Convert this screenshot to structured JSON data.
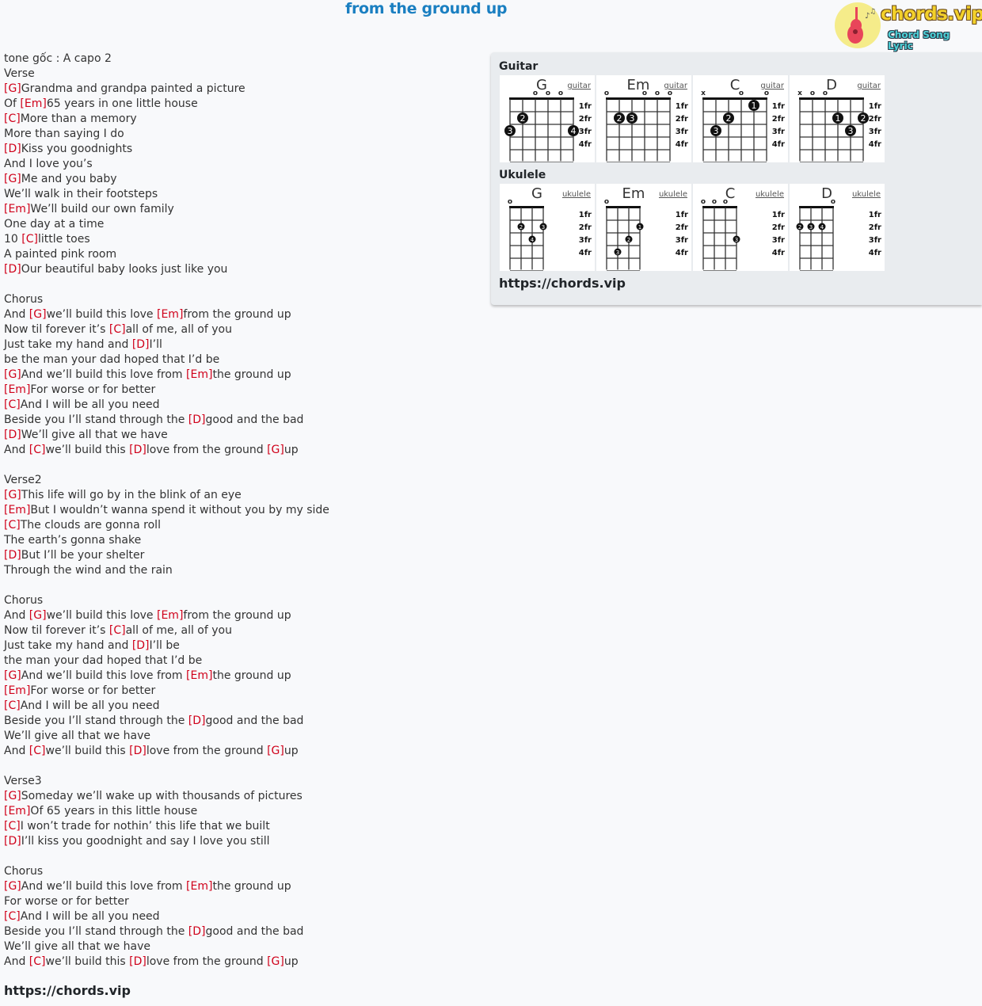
{
  "song": {
    "title": "from the ground up"
  },
  "logo": {
    "name": "chords.vip",
    "tagline": "Chord Song Lyric"
  },
  "lyrics": [
    [
      {
        "t": "tone gốc : A capo 2"
      }
    ],
    [
      {
        "t": "Verse"
      }
    ],
    [
      {
        "c": "[G]"
      },
      {
        "t": "Grandma and grandpa painted a picture"
      }
    ],
    [
      {
        "t": "Of "
      },
      {
        "c": "[Em]"
      },
      {
        "t": "65 years in one little house"
      }
    ],
    [
      {
        "c": "[C]"
      },
      {
        "t": "More than a memory"
      }
    ],
    [
      {
        "t": "More than saying I do"
      }
    ],
    [
      {
        "c": "[D]"
      },
      {
        "t": "Kiss you goodnights"
      }
    ],
    [
      {
        "t": "And I love you’s"
      }
    ],
    [
      {
        "c": "[G]"
      },
      {
        "t": "Me and you baby"
      }
    ],
    [
      {
        "t": "We’ll walk in their footsteps"
      }
    ],
    [
      {
        "c": "[Em]"
      },
      {
        "t": "We’ll build our own family"
      }
    ],
    [
      {
        "t": "One day at a time"
      }
    ],
    [
      {
        "t": "10 "
      },
      {
        "c": "[C]"
      },
      {
        "t": "little toes"
      }
    ],
    [
      {
        "t": "A painted pink room"
      }
    ],
    [
      {
        "c": "[D]"
      },
      {
        "t": "Our beautiful baby looks just like you"
      }
    ],
    [],
    [
      {
        "t": "Chorus"
      }
    ],
    [
      {
        "t": "And "
      },
      {
        "c": "[G]"
      },
      {
        "t": "we’ll build this love "
      },
      {
        "c": "[Em]"
      },
      {
        "t": "from the ground up"
      }
    ],
    [
      {
        "t": "Now til forever it’s "
      },
      {
        "c": "[C]"
      },
      {
        "t": "all of me, all of you"
      }
    ],
    [
      {
        "t": "Just take my hand and "
      },
      {
        "c": "[D]"
      },
      {
        "t": "I’ll"
      }
    ],
    [
      {
        "t": "be the man your dad hoped that I’d be"
      }
    ],
    [
      {
        "c": "[G]"
      },
      {
        "t": "And we’ll build this love from "
      },
      {
        "c": "[Em]"
      },
      {
        "t": "the ground up"
      }
    ],
    [
      {
        "c": "[Em]"
      },
      {
        "t": "For worse or for better"
      }
    ],
    [
      {
        "c": "[C]"
      },
      {
        "t": "And I will be all you need"
      }
    ],
    [
      {
        "t": "Beside you I’ll stand through the "
      },
      {
        "c": "[D]"
      },
      {
        "t": "good and the bad"
      }
    ],
    [
      {
        "c": "[D]"
      },
      {
        "t": "We’ll give all that we have"
      }
    ],
    [
      {
        "t": "And "
      },
      {
        "c": "[C]"
      },
      {
        "t": "we’ll build this "
      },
      {
        "c": "[D]"
      },
      {
        "t": "love from the ground "
      },
      {
        "c": "[G]"
      },
      {
        "t": "up"
      }
    ],
    [],
    [
      {
        "t": "Verse2"
      }
    ],
    [
      {
        "c": "[G]"
      },
      {
        "t": "This life will go by in the blink of an eye"
      }
    ],
    [
      {
        "c": "[Em]"
      },
      {
        "t": "But I wouldn’t wanna spend it without you by my side"
      }
    ],
    [
      {
        "c": "[C]"
      },
      {
        "t": "The clouds are gonna roll"
      }
    ],
    [
      {
        "t": "The earth’s gonna shake"
      }
    ],
    [
      {
        "c": "[D]"
      },
      {
        "t": "But I’ll be your shelter"
      }
    ],
    [
      {
        "t": "Through the wind and the rain"
      }
    ],
    [],
    [
      {
        "t": "Chorus"
      }
    ],
    [
      {
        "t": "And "
      },
      {
        "c": "[G]"
      },
      {
        "t": "we’ll build this love "
      },
      {
        "c": "[Em]"
      },
      {
        "t": "from the ground up"
      }
    ],
    [
      {
        "t": "Now til forever it’s "
      },
      {
        "c": "[C]"
      },
      {
        "t": "all of me, all of you"
      }
    ],
    [
      {
        "t": "Just take my hand and "
      },
      {
        "c": "[D]"
      },
      {
        "t": "I’ll be"
      }
    ],
    [
      {
        "t": "the man your dad hoped that I’d be"
      }
    ],
    [
      {
        "c": "[G]"
      },
      {
        "t": "And we’ll build this love from "
      },
      {
        "c": "[Em]"
      },
      {
        "t": "the ground up"
      }
    ],
    [
      {
        "c": "[Em]"
      },
      {
        "t": "For worse or for better"
      }
    ],
    [
      {
        "c": "[C]"
      },
      {
        "t": "And I will be all you need"
      }
    ],
    [
      {
        "t": "Beside you I’ll stand through the "
      },
      {
        "c": "[D]"
      },
      {
        "t": "good and the bad"
      }
    ],
    [
      {
        "t": "We’ll give all that we have"
      }
    ],
    [
      {
        "t": "And "
      },
      {
        "c": "[C]"
      },
      {
        "t": "we’ll build this "
      },
      {
        "c": "[D]"
      },
      {
        "t": "love from the ground "
      },
      {
        "c": "[G]"
      },
      {
        "t": "up"
      }
    ],
    [],
    [
      {
        "t": "Verse3"
      }
    ],
    [
      {
        "c": "[G]"
      },
      {
        "t": "Someday we’ll wake up with thousands of pictures"
      }
    ],
    [
      {
        "c": "[Em]"
      },
      {
        "t": "Of 65 years in this little house"
      }
    ],
    [
      {
        "c": "[C]"
      },
      {
        "t": "I won’t trade for nothin’ this life that we built"
      }
    ],
    [
      {
        "c": "[D]"
      },
      {
        "t": "I’ll kiss you goodnight and say I love you still"
      }
    ],
    [],
    [
      {
        "t": "Chorus"
      }
    ],
    [
      {
        "c": "[G]"
      },
      {
        "t": "And we’ll build this love from "
      },
      {
        "c": "[Em]"
      },
      {
        "t": "the ground up"
      }
    ],
    [
      {
        "t": "For worse or for better"
      }
    ],
    [
      {
        "c": "[C]"
      },
      {
        "t": "And I will be all you need"
      }
    ],
    [
      {
        "t": "Beside you I’ll stand through the "
      },
      {
        "c": "[D]"
      },
      {
        "t": "good and the bad"
      }
    ],
    [
      {
        "t": "We’ll give all that we have"
      }
    ],
    [
      {
        "t": "And "
      },
      {
        "c": "[C]"
      },
      {
        "t": "we’ll build this "
      },
      {
        "c": "[D]"
      },
      {
        "t": "love from the ground "
      },
      {
        "c": "[G]"
      },
      {
        "t": "up"
      }
    ]
  ],
  "footer": {
    "link": "https://chords.vip"
  },
  "panel": {
    "guitar_heading": "Guitar",
    "ukulele_heading": "Ukulele",
    "link": "https://chords.vip",
    "fret_labels": [
      "1fr",
      "2fr",
      "3fr",
      "4fr"
    ],
    "colors": {
      "chord": "#d0021b",
      "title": "#1a7fc1",
      "panel_bg": "#e9ecef"
    },
    "guitar": [
      {
        "name": "G",
        "link": "guitar",
        "markers": [
          "",
          "",
          "o",
          "o",
          "o",
          ""
        ],
        "dots": [
          {
            "s": 1,
            "f": 2,
            "n": "2"
          },
          {
            "s": 0,
            "f": 3,
            "n": "3"
          },
          {
            "s": 5,
            "f": 3,
            "n": "4"
          }
        ]
      },
      {
        "name": "Em",
        "link": "guitar",
        "markers": [
          "o",
          "",
          "",
          "o",
          "o",
          "o"
        ],
        "dots": [
          {
            "s": 1,
            "f": 2,
            "n": "2"
          },
          {
            "s": 2,
            "f": 2,
            "n": "3"
          }
        ]
      },
      {
        "name": "C",
        "link": "guitar",
        "markers": [
          "x",
          "",
          "",
          "o",
          "",
          "o"
        ],
        "dots": [
          {
            "s": 4,
            "f": 1,
            "n": "1"
          },
          {
            "s": 2,
            "f": 2,
            "n": "2"
          },
          {
            "s": 1,
            "f": 3,
            "n": "3"
          }
        ]
      },
      {
        "name": "D",
        "link": "guitar",
        "markers": [
          "x",
          "o",
          "o",
          "",
          "",
          ""
        ],
        "dots": [
          {
            "s": 3,
            "f": 2,
            "n": "1"
          },
          {
            "s": 5,
            "f": 2,
            "n": "2"
          },
          {
            "s": 4,
            "f": 3,
            "n": "3"
          }
        ]
      }
    ],
    "ukulele": [
      {
        "name": "G",
        "link": "ukulele",
        "markers": [
          "o",
          "",
          "",
          ""
        ],
        "dots": [
          {
            "s": 1,
            "f": 2,
            "n": "2"
          },
          {
            "s": 3,
            "f": 2,
            "n": "3"
          },
          {
            "s": 2,
            "f": 3,
            "n": "4"
          }
        ]
      },
      {
        "name": "Em",
        "link": "ukulele",
        "markers": [
          "o",
          "",
          "",
          ""
        ],
        "dots": [
          {
            "s": 3,
            "f": 2,
            "n": "1"
          },
          {
            "s": 2,
            "f": 3,
            "n": "2"
          },
          {
            "s": 1,
            "f": 4,
            "n": "3"
          }
        ]
      },
      {
        "name": "C",
        "link": "ukulele",
        "markers": [
          "o",
          "o",
          "o",
          ""
        ],
        "dots": [
          {
            "s": 3,
            "f": 3,
            "n": "3"
          }
        ]
      },
      {
        "name": "D",
        "link": "ukulele",
        "markers": [
          "",
          "",
          "",
          "o"
        ],
        "dots": [
          {
            "s": 0,
            "f": 2,
            "n": "2"
          },
          {
            "s": 1,
            "f": 2,
            "n": "3"
          },
          {
            "s": 2,
            "f": 2,
            "n": "4"
          }
        ]
      }
    ]
  }
}
